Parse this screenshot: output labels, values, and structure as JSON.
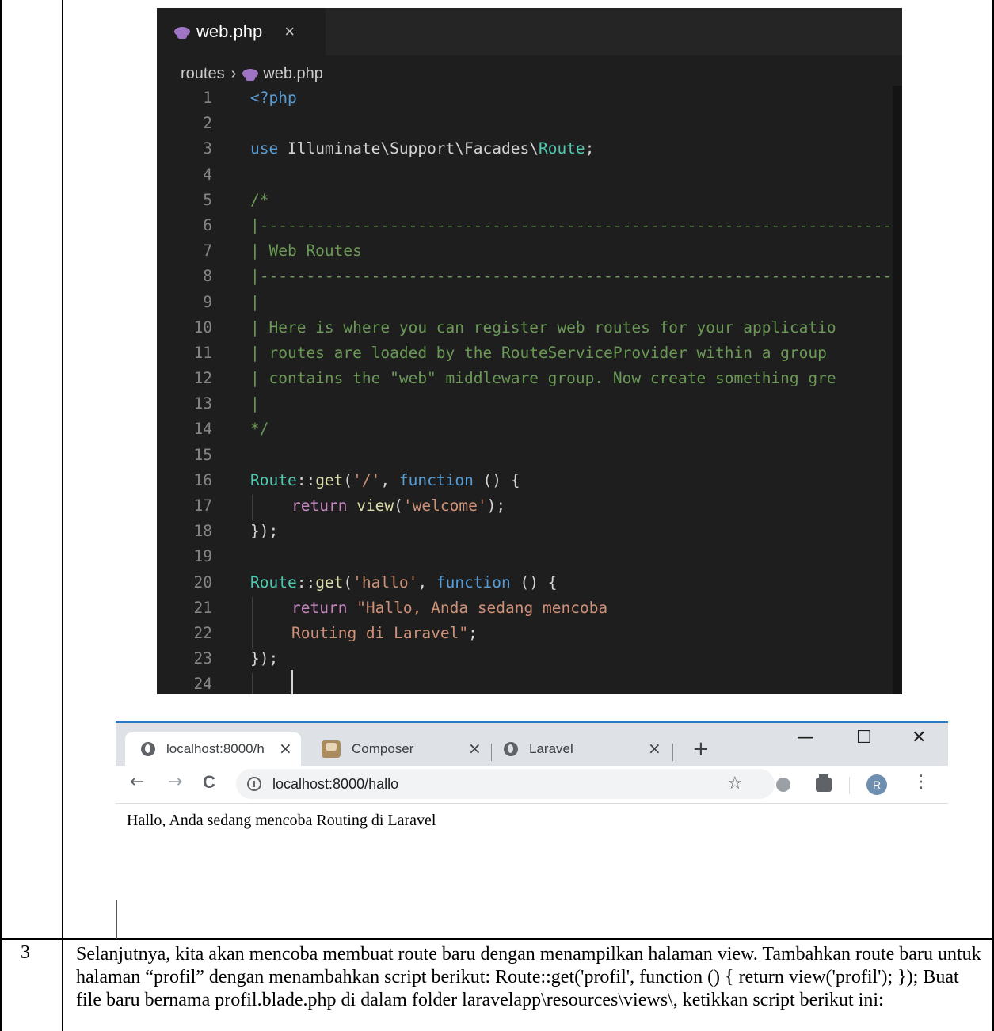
{
  "rows": {
    "row3_number": "3"
  },
  "editor": {
    "tab_label": "web.php",
    "tab_close": "×",
    "breadcrumb_folder": "routes",
    "breadcrumb_sep": "›",
    "breadcrumb_file": "web.php",
    "lines": [
      {
        "n": "1"
      },
      {
        "n": "2"
      },
      {
        "n": "3"
      },
      {
        "n": "4"
      },
      {
        "n": "5"
      },
      {
        "n": "6"
      },
      {
        "n": "7"
      },
      {
        "n": "8"
      },
      {
        "n": "9"
      },
      {
        "n": "10"
      },
      {
        "n": "11"
      },
      {
        "n": "12"
      },
      {
        "n": "13"
      },
      {
        "n": "14"
      },
      {
        "n": "15"
      },
      {
        "n": "16"
      },
      {
        "n": "17"
      },
      {
        "n": "18"
      },
      {
        "n": "19"
      },
      {
        "n": "20"
      },
      {
        "n": "21"
      },
      {
        "n": "22"
      },
      {
        "n": "23"
      },
      {
        "n": "24"
      }
    ],
    "code": {
      "l1": "<?php",
      "l3_use": "use",
      "l3_ns": " Illuminate\\Support\\Facades\\",
      "l3_cls": "Route",
      "l3_end": ";",
      "l5": "/*",
      "l6": "|-------------------------------------------------------------------------",
      "l7": "| Web Routes",
      "l8": "|-------------------------------------------------------------------------",
      "l9": "|",
      "l10": "| Here is where you can register web routes for your applicatio",
      "l11": "| routes are loaded by the RouteServiceProvider within a group",
      "l12": "| contains the \"web\" middleware group. Now create something gre",
      "l13": "|",
      "l14": "*/",
      "l16_cls": "Route",
      "l16_op": "::",
      "l16_fn": "get",
      "l16_p1": "(",
      "l16_str": "'/'",
      "l16_p2": ", ",
      "l16_kw": "function",
      "l16_end": " () {",
      "l17_ret": "return",
      "l17_sp": " ",
      "l17_fn": "view",
      "l17_p1": "(",
      "l17_str": "'welcome'",
      "l17_end": ");",
      "l18": "});",
      "l20_cls": "Route",
      "l20_op": "::",
      "l20_fn": "get",
      "l20_p1": "(",
      "l20_str": "'hallo'",
      "l20_p2": ", ",
      "l20_kw": "function",
      "l20_end": " () {",
      "l21_ret": "return",
      "l21_str": " \"Hallo, Anda sedang mencoba",
      "l22_str": "Routing di Laravel\"",
      "l22_end": ";",
      "l23": "});"
    },
    "colors": {
      "background": "#1e1e1e",
      "keyword": "#569cd6",
      "control": "#c586c0",
      "function": "#dcdcaa",
      "string": "#ce9178",
      "comment": "#6a9955",
      "class": "#4ec9b0"
    }
  },
  "browser": {
    "tabs": [
      {
        "label": "localhost:8000/h",
        "close": "×",
        "icon": "globe-icon"
      },
      {
        "label": "Composer",
        "close": "×",
        "icon": "composer-icon"
      },
      {
        "label": "Laravel",
        "close": "×",
        "icon": "globe-icon"
      }
    ],
    "new_tab": "+",
    "window": {
      "minimize": "—",
      "maximize": "☐",
      "close": "✕"
    },
    "nav": {
      "back": "←",
      "forward": "→",
      "reload": "C"
    },
    "url": "localhost:8000/hallo",
    "star": "☆",
    "avatar_letter": "R",
    "menu": "⋮",
    "content_text": "Hallo, Anda sedang mencoba Routing di Laravel"
  },
  "paragraph": "Selanjutnya, kita akan mencoba membuat route baru dengan menampilkan halaman view. Tambahkan route baru untuk halaman “profil” dengan menambahkan script berikut: Route::get('profil', function () { return view('profil'); }); Buat file baru bernama profil.blade.php di dalam folder laravelapp\\resources\\views\\, ketikkan script berikut ini:"
}
